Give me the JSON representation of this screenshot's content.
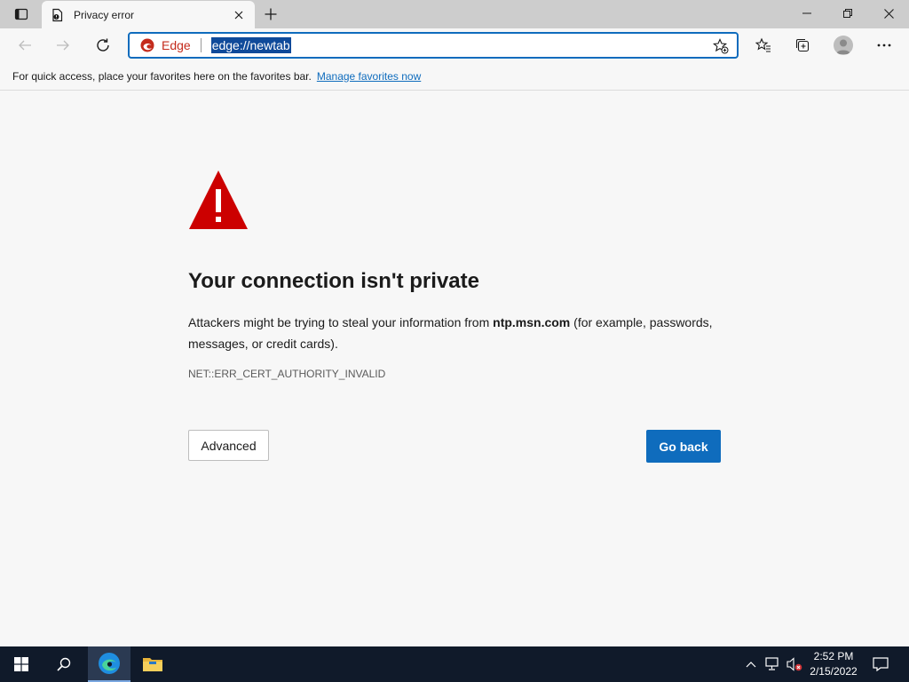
{
  "tab": {
    "title": "Privacy error"
  },
  "omnibox": {
    "brand": "Edge",
    "url": "edge://newtab"
  },
  "favorites_bar": {
    "message": "For quick access, place your favorites here on the favorites bar.",
    "link": "Manage favorites now"
  },
  "error_page": {
    "heading": "Your connection isn't private",
    "desc_before": "Attackers might be trying to steal your information from ",
    "host": "ntp.msn.com",
    "desc_after": " (for example, passwords, messages, or credit cards).",
    "error_code": "NET::ERR_CERT_AUTHORITY_INVALID",
    "advanced_label": "Advanced",
    "go_back_label": "Go back"
  },
  "taskbar": {
    "time": "2:52 PM",
    "date": "2/15/2022"
  },
  "colors": {
    "accent": "#0f6cbd",
    "warning_red": "#cc0000",
    "brand_red": "#c42b1c"
  },
  "icons": [
    "tab-actions-icon",
    "favicon-icon",
    "close-icon",
    "plus-icon",
    "minimize-icon",
    "restore-icon",
    "back-icon",
    "forward-icon",
    "refresh-icon",
    "edge-logo-icon",
    "add-favorite-icon",
    "favorites-icon",
    "collections-icon",
    "profile-icon",
    "more-icon",
    "warning-icon",
    "windows-icon",
    "search-icon",
    "file-explorer-icon",
    "network-icon",
    "volume-muted-icon",
    "notification-icon"
  ]
}
